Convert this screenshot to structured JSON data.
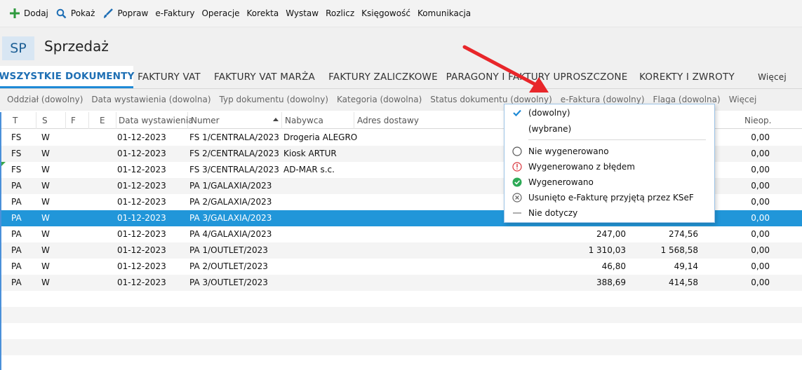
{
  "toolbar": {
    "buttons": [
      {
        "label": "Dodaj",
        "icon": "plus-icon"
      },
      {
        "label": "Pokaż",
        "icon": "search-icon"
      },
      {
        "label": "Popraw",
        "icon": "brush-icon"
      },
      {
        "label": "e-Faktury"
      },
      {
        "label": "Operacje"
      },
      {
        "label": "Korekta"
      },
      {
        "label": "Wystaw"
      },
      {
        "label": "Rozlicz"
      },
      {
        "label": "Księgowość"
      },
      {
        "label": "Komunikacja"
      }
    ]
  },
  "module": {
    "badge": "SP",
    "title": "Sprzedaż"
  },
  "tabs": [
    {
      "label": "WSZYSTKIE DOKUMENTY",
      "active": true
    },
    {
      "label": "FAKTURY VAT"
    },
    {
      "label": "FAKTURY VAT MARŻA"
    },
    {
      "label": "FAKTURY ZALICZKOWE"
    },
    {
      "label": "PARAGONY I FAKTURY UPROSZCZONE"
    },
    {
      "label": "KOREKTY I ZWROTY"
    },
    {
      "label": "Więcej"
    }
  ],
  "filters": [
    "Oddział (dowolny)",
    "Data wystawienia (dowolna)",
    "Typ dokumentu (dowolny)",
    "Kategoria (dowolna)",
    "Status dokumentu (dowolny)",
    "e-Faktura (dowolny)",
    "Flaga (dowolna)",
    "Więcej"
  ],
  "grid": {
    "columns": [
      "T",
      "S",
      "F",
      "E",
      "Data wystawienia",
      "Numer",
      "Nabywca",
      "Adres dostawy",
      "Nieop."
    ],
    "rows": [
      {
        "t": "FS",
        "s": "W",
        "date": "01-12-2023",
        "number": "FS 1/CENTRALA/2023",
        "buyer": "Drogeria ALEGRO",
        "net": "",
        "gross": "",
        "unpaid": "0,00"
      },
      {
        "t": "FS",
        "s": "W",
        "date": "01-12-2023",
        "number": "FS 2/CENTRALA/2023",
        "buyer": "Kiosk ARTUR",
        "net": "",
        "gross": "",
        "unpaid": "0,00"
      },
      {
        "t": "FS",
        "s": "W",
        "date": "01-12-2023",
        "number": "FS 3/CENTRALA/2023",
        "buyer": "AD-MAR s.c.",
        "net": "",
        "gross": "",
        "unpaid": "0,00",
        "flag": true
      },
      {
        "t": "PA",
        "s": "W",
        "date": "01-12-2023",
        "number": "PA 1/GALAXIA/2023",
        "buyer": "",
        "net": "",
        "gross": "",
        "unpaid": "0,00"
      },
      {
        "t": "PA",
        "s": "W",
        "date": "01-12-2023",
        "number": "PA 2/GALAXIA/2023",
        "buyer": "",
        "net": "",
        "gross": "",
        "unpaid": "0,00"
      },
      {
        "t": "PA",
        "s": "W",
        "date": "01-12-2023",
        "number": "PA 3/GALAXIA/2023",
        "buyer": "",
        "net": "",
        "gross": "",
        "unpaid": "0,00",
        "selected": true
      },
      {
        "t": "PA",
        "s": "W",
        "date": "01-12-2023",
        "number": "PA 4/GALAXIA/2023",
        "buyer": "",
        "net": "247,00",
        "gross": "274,56",
        "unpaid": "0,00"
      },
      {
        "t": "PA",
        "s": "W",
        "date": "01-12-2023",
        "number": "PA 1/OUTLET/2023",
        "buyer": "",
        "net": "1 310,03",
        "gross": "1 568,58",
        "unpaid": "0,00"
      },
      {
        "t": "PA",
        "s": "W",
        "date": "01-12-2023",
        "number": "PA 2/OUTLET/2023",
        "buyer": "",
        "net": "46,80",
        "gross": "49,14",
        "unpaid": "0,00"
      },
      {
        "t": "PA",
        "s": "W",
        "date": "01-12-2023",
        "number": "PA 3/OUTLET/2023",
        "buyer": "",
        "net": "388,69",
        "gross": "414,58",
        "unpaid": "0,00"
      }
    ]
  },
  "dropdown": {
    "items": [
      {
        "label": "(dowolny)",
        "icon": "checkmark-icon"
      },
      {
        "label": "(wybrane)",
        "icon": ""
      },
      {
        "label": "Nie wygenerowano",
        "icon": "empty-circle-icon"
      },
      {
        "label": "Wygenerowano z błędem",
        "icon": "error-circle-icon"
      },
      {
        "label": "Wygenerowano",
        "icon": "success-circle-icon"
      },
      {
        "label": "Usunięto e-Fakturę przyjętą przez KSeF",
        "icon": "cross-circle-icon"
      },
      {
        "label": "Nie dotyczy",
        "icon": "dash-icon"
      }
    ]
  },
  "colors": {
    "accent": "#1e8ad6",
    "selected_row": "#2196d9",
    "annotation_arrow": "#e8262a",
    "success": "#2daa56",
    "error": "#d9363e"
  }
}
